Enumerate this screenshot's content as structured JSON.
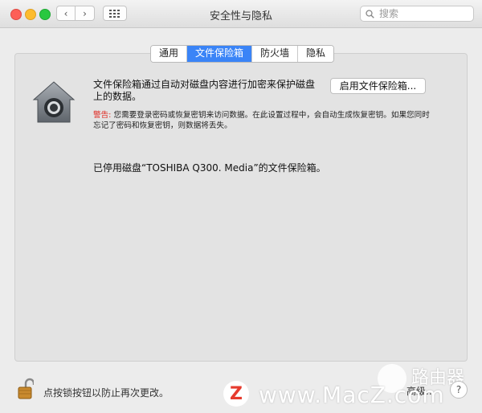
{
  "window": {
    "title": "安全性与隐私"
  },
  "nav": {
    "back": "‹",
    "forward": "›",
    "grid": "⋯"
  },
  "search": {
    "placeholder": "搜索"
  },
  "tabs": [
    {
      "label": "通用",
      "active": false
    },
    {
      "label": "文件保险箱",
      "active": true
    },
    {
      "label": "防火墙",
      "active": false
    },
    {
      "label": "隐私",
      "active": false
    }
  ],
  "filevault": {
    "description": "文件保险箱通过自动对磁盘内容进行加密来保护磁盘上的数据。",
    "enable_button": "启用文件保险箱...",
    "warning_label": "警告:",
    "warning_text": "您需要登录密码或恢复密钥来访问数据。在此设置过程中，会自动生成恢复密钥。如果您同时忘记了密码和恢复密钥，则数据将丢失。",
    "status": "已停用磁盘“TOSHIBA Q300. Media”的文件保险箱。"
  },
  "footer": {
    "lock_hint": "点按锁按钮以防止再次更改。",
    "advanced": "高级...",
    "help": "?"
  },
  "watermark": {
    "logo_letter": "Z",
    "url": "www.MacZ.com",
    "router_text": "路由器"
  },
  "colors": {
    "accent": "#3a84f7",
    "warning": "#e0261e",
    "close": "#fd5f57",
    "minimize": "#fdbc2e",
    "maximize": "#28c840"
  },
  "icons": [
    "filevault-house-icon",
    "padlock-open-icon",
    "search-icon",
    "chevron-left-icon",
    "chevron-right-icon",
    "grid-icon",
    "help-icon"
  ]
}
